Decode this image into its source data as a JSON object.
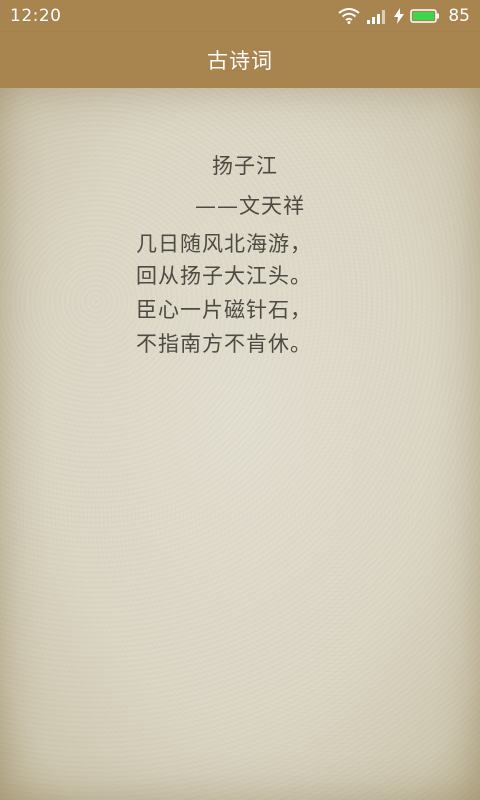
{
  "status_bar": {
    "time": "12:20",
    "battery_level": "85",
    "icons": [
      "wifi-icon",
      "signal-icon",
      "charging-bolt-icon",
      "battery-icon"
    ],
    "battery_color": "#3cd64a"
  },
  "app_bar": {
    "title": "古诗词",
    "background": "#a8844f"
  },
  "poem": {
    "title": "扬子江",
    "author": "——文天祥",
    "lines": [
      "几日随风北海游，",
      "回从扬子大江头。",
      "臣心一片磁针石，",
      "不指南方不肯休。"
    ]
  }
}
